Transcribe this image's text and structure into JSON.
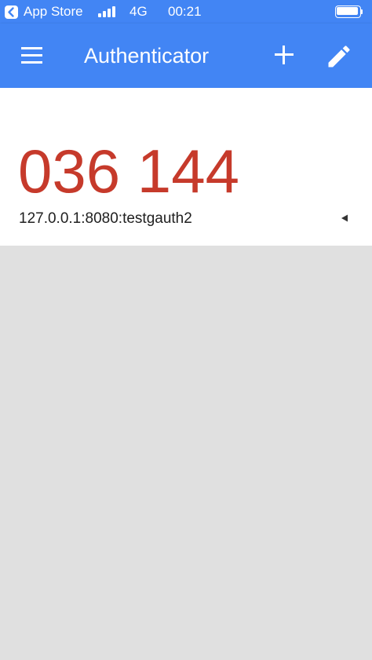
{
  "status_bar": {
    "back_app": "App Store",
    "network": "4G",
    "time": "00:21",
    "signal_bars": 4,
    "battery_level": 1.0
  },
  "app_bar": {
    "title": "Authenticator",
    "icons": {
      "menu": "menu-icon",
      "add": "plus-icon",
      "edit": "pencil-icon"
    }
  },
  "account": {
    "code": "036 144",
    "name": "127.0.0.1:8080:testgauth2",
    "timer_icon": "countdown-indicator-icon"
  },
  "colors": {
    "primary": "#4285f4",
    "code": "#c63a2b",
    "background": "#e0e0e0",
    "card": "#ffffff"
  }
}
